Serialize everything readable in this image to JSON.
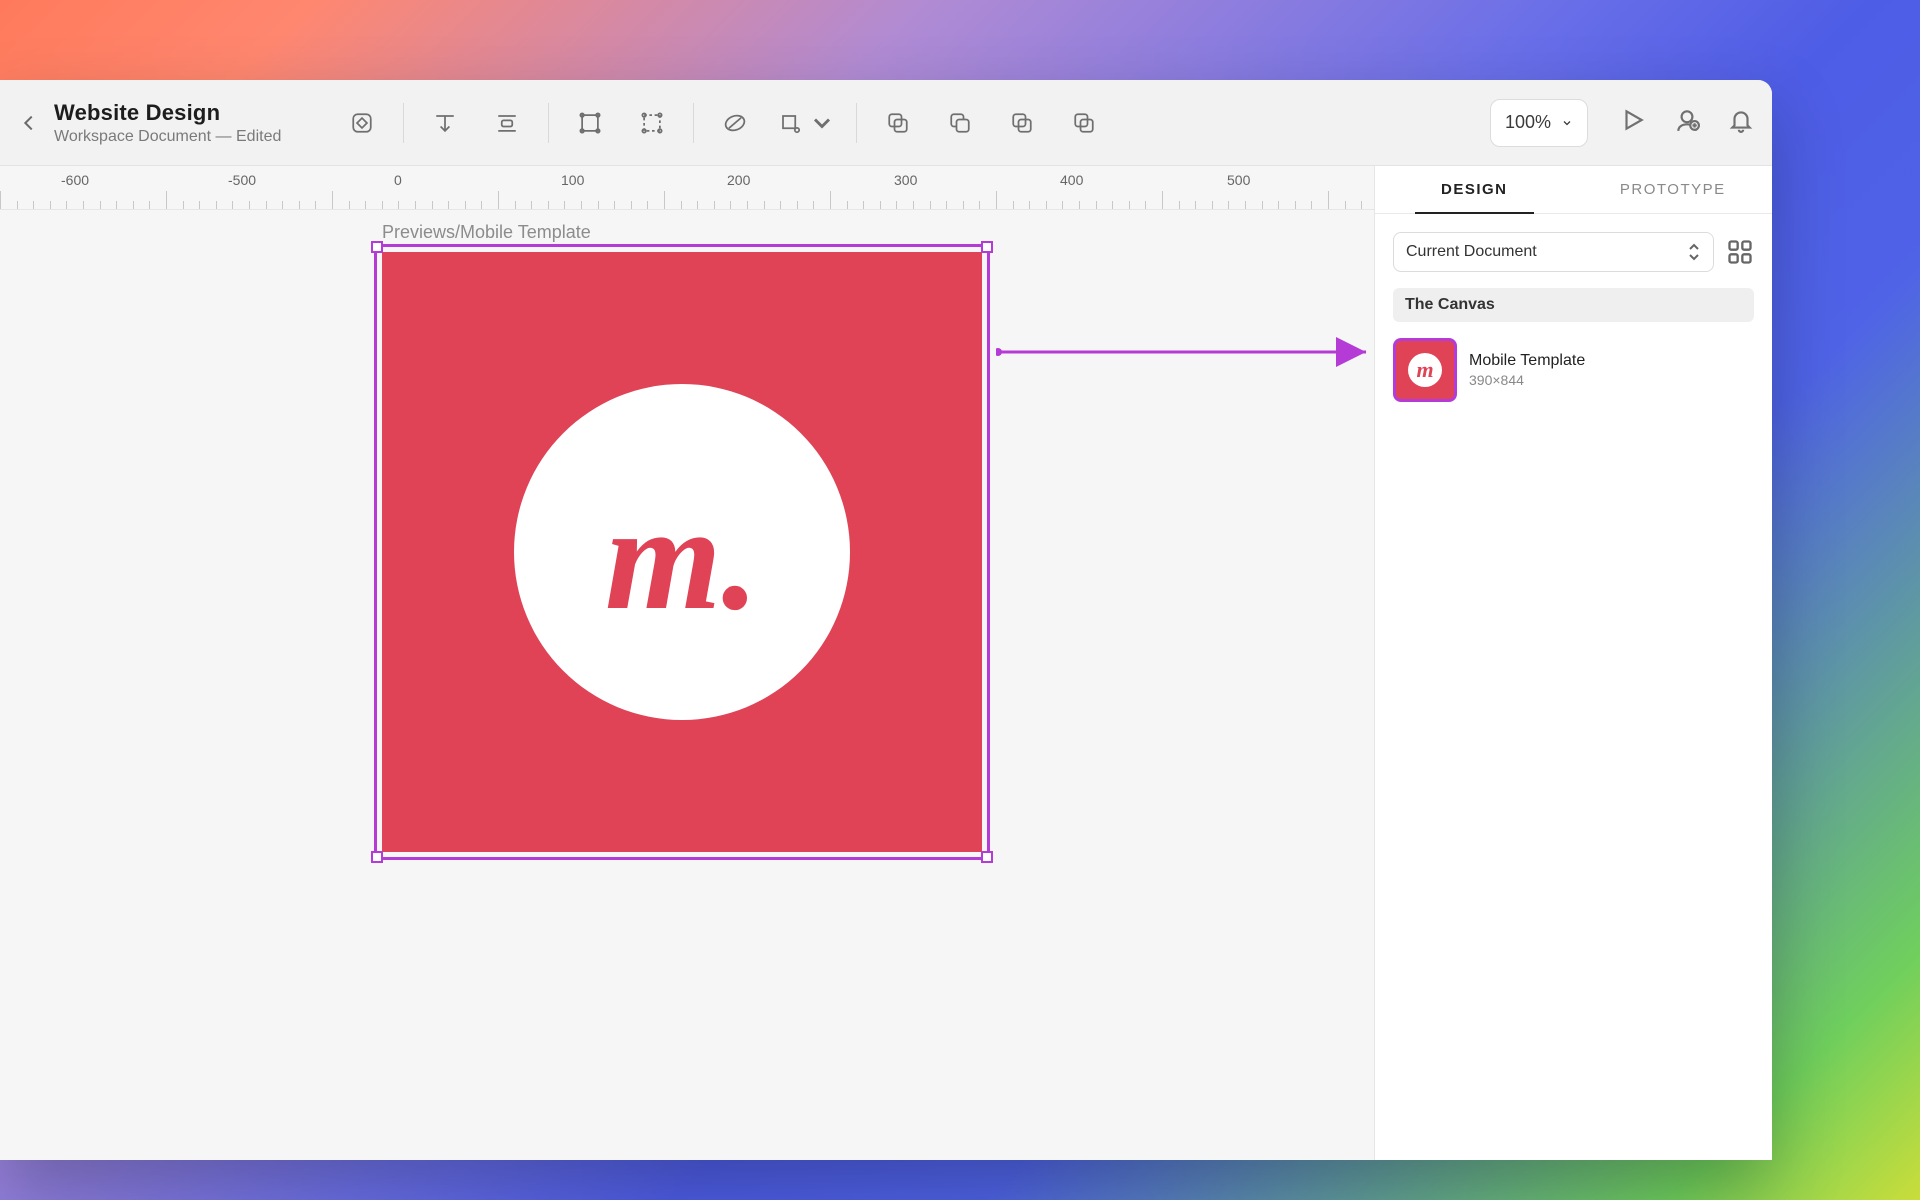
{
  "window": {
    "title": "Website Design",
    "subtitle": "Workspace Document — Edited"
  },
  "toolbar": {
    "zoom": "100%"
  },
  "ruler": {
    "marks": [
      "-600",
      "-500",
      "0",
      "100",
      "200",
      "300",
      "400",
      "500"
    ]
  },
  "canvas": {
    "artboard_label": "Previews/Mobile Template",
    "logo_letter": "m."
  },
  "inspector": {
    "tabs": {
      "design": "DESIGN",
      "prototype": "PROTOTYPE"
    },
    "scope": "Current Document",
    "section": "The Canvas",
    "asset": {
      "name": "Mobile Template",
      "size": "390×844",
      "thumb_letter": "m"
    }
  }
}
